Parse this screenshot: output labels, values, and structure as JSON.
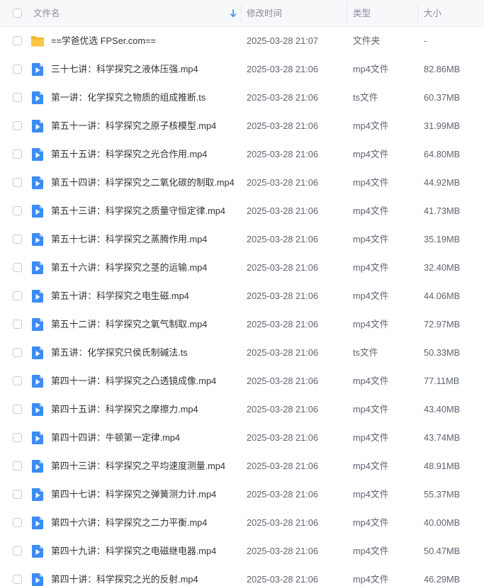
{
  "header": {
    "name_label": "文件名",
    "time_label": "修改时间",
    "type_label": "类型",
    "size_label": "大小",
    "sort_icon": "sort-down-arrow-icon",
    "accent_color": "#3b8cf5"
  },
  "files": [
    {
      "icon": "folder-icon",
      "name": "==学爸优选 FPSer.com==",
      "time": "2025-03-28 21:07",
      "type": "文件夹",
      "size": "-"
    },
    {
      "icon": "video-file-icon",
      "name": "三十七讲：科学探究之液体压强.mp4",
      "time": "2025-03-28 21:06",
      "type": "mp4文件",
      "size": "82.86MB"
    },
    {
      "icon": "video-file-icon",
      "name": "第一讲：化学探究之物质的组成推断.ts",
      "time": "2025-03-28 21:06",
      "type": "ts文件",
      "size": "60.37MB"
    },
    {
      "icon": "video-file-icon",
      "name": "第五十一讲：科学探究之原子核模型.mp4",
      "time": "2025-03-28 21:06",
      "type": "mp4文件",
      "size": "31.99MB"
    },
    {
      "icon": "video-file-icon",
      "name": "第五十五讲：科学探究之光合作用.mp4",
      "time": "2025-03-28 21:06",
      "type": "mp4文件",
      "size": "64.80MB"
    },
    {
      "icon": "video-file-icon",
      "name": "第五十四讲：科学探究之二氧化碳的制取.mp4",
      "time": "2025-03-28 21:06",
      "type": "mp4文件",
      "size": "44.92MB"
    },
    {
      "icon": "video-file-icon",
      "name": "第五十三讲：科学探究之质量守恒定律.mp4",
      "time": "2025-03-28 21:06",
      "type": "mp4文件",
      "size": "41.73MB"
    },
    {
      "icon": "video-file-icon",
      "name": "第五十七讲：科学探究之蒸腾作用.mp4",
      "time": "2025-03-28 21:06",
      "type": "mp4文件",
      "size": "35.19MB"
    },
    {
      "icon": "video-file-icon",
      "name": "第五十六讲：科学探究之茎的运输.mp4",
      "time": "2025-03-28 21:06",
      "type": "mp4文件",
      "size": "32.40MB"
    },
    {
      "icon": "video-file-icon",
      "name": "第五十讲：科学探究之电生磁.mp4",
      "time": "2025-03-28 21:06",
      "type": "mp4文件",
      "size": "44.06MB"
    },
    {
      "icon": "video-file-icon",
      "name": "第五十二讲：科学探究之氧气制取.mp4",
      "time": "2025-03-28 21:06",
      "type": "mp4文件",
      "size": "72.97MB"
    },
    {
      "icon": "video-file-icon",
      "name": "第五讲：化学探究只侯氏制碱法.ts",
      "time": "2025-03-28 21:06",
      "type": "ts文件",
      "size": "50.33MB"
    },
    {
      "icon": "video-file-icon",
      "name": "第四十一讲：科学探究之凸透镜成像.mp4",
      "time": "2025-03-28 21:06",
      "type": "mp4文件",
      "size": "77.11MB"
    },
    {
      "icon": "video-file-icon",
      "name": "第四十五讲：科学探究之摩擦力.mp4",
      "time": "2025-03-28 21:06",
      "type": "mp4文件",
      "size": "43.40MB"
    },
    {
      "icon": "video-file-icon",
      "name": "第四十四讲：牛顿第一定律.mp4",
      "time": "2025-03-28 21:06",
      "type": "mp4文件",
      "size": "43.74MB"
    },
    {
      "icon": "video-file-icon",
      "name": "第四十三讲：科学探究之平均速度测量.mp4",
      "time": "2025-03-28 21:06",
      "type": "mp4文件",
      "size": "48.91MB"
    },
    {
      "icon": "video-file-icon",
      "name": "第四十七讲：科学探究之弹簧测力计.mp4",
      "time": "2025-03-28 21:06",
      "type": "mp4文件",
      "size": "55.37MB"
    },
    {
      "icon": "video-file-icon",
      "name": "第四十六讲：科学探究之二力平衡.mp4",
      "time": "2025-03-28 21:06",
      "type": "mp4文件",
      "size": "40.00MB"
    },
    {
      "icon": "video-file-icon",
      "name": "第四十九讲：科学探究之电磁继电器.mp4",
      "time": "2025-03-28 21:06",
      "type": "mp4文件",
      "size": "50.47MB"
    },
    {
      "icon": "video-file-icon",
      "name": "第四十讲：科学探究之光的反射.mp4",
      "time": "2025-03-28 21:06",
      "type": "mp4文件",
      "size": "46.29MB"
    }
  ]
}
